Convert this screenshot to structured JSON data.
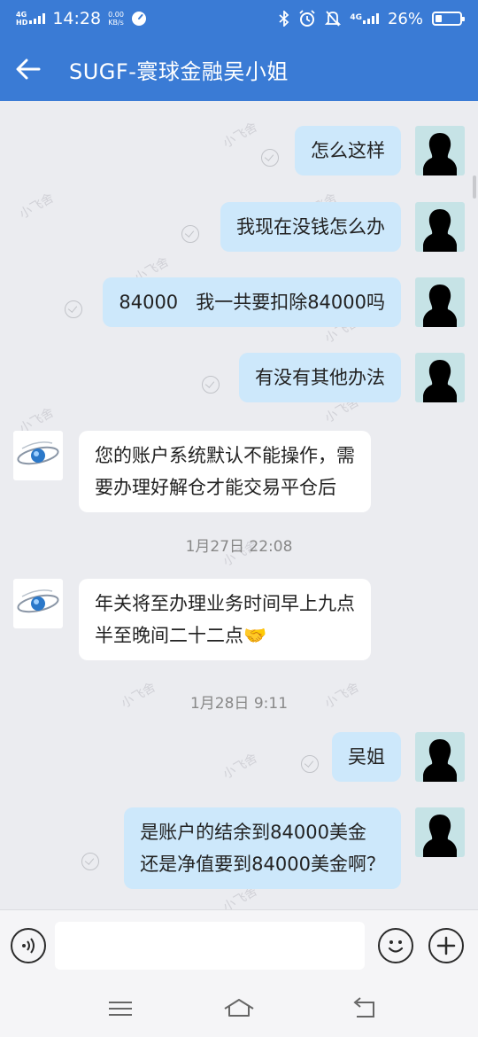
{
  "status_bar": {
    "network": "4G",
    "network_hd": "HD",
    "time": "14:28",
    "speed_value": "0.00",
    "speed_unit": "KB/s",
    "signal_4g": "4G",
    "battery": "26%",
    "battery_level": 0.26
  },
  "header": {
    "title": "SUGF-寰球金融吴小姐"
  },
  "messages": [
    {
      "text": "怎么这样"
    },
    {
      "text": "我现在没钱怎么办"
    },
    {
      "text": "84000   我一共要扣除84000吗"
    },
    {
      "text": "有没有其他办法"
    },
    {
      "lines": [
        "您的账户系统默认不能操作，需",
        "要办理好解仓才能交易平仓后"
      ]
    },
    {
      "lines": [
        "年关将至办理业务时间早上九点",
        "半至晚间二十二点"
      ],
      "emoji": "🤝"
    },
    {
      "text": "吴姐"
    },
    {
      "lines": [
        "是账户的结余到84000美金",
        "还是净值要到84000美金啊？"
      ]
    }
  ],
  "timestamps": [
    "1月27日   22:08",
    "1月28日   9:11"
  ],
  "watermark": "小飞舍",
  "input": {
    "value": "",
    "placeholder": ""
  },
  "colors": {
    "header": "#3a7bd5",
    "outgoing_bubble": "#cde8fb",
    "incoming_bubble": "#ffffff",
    "background": "#ebecf0"
  }
}
